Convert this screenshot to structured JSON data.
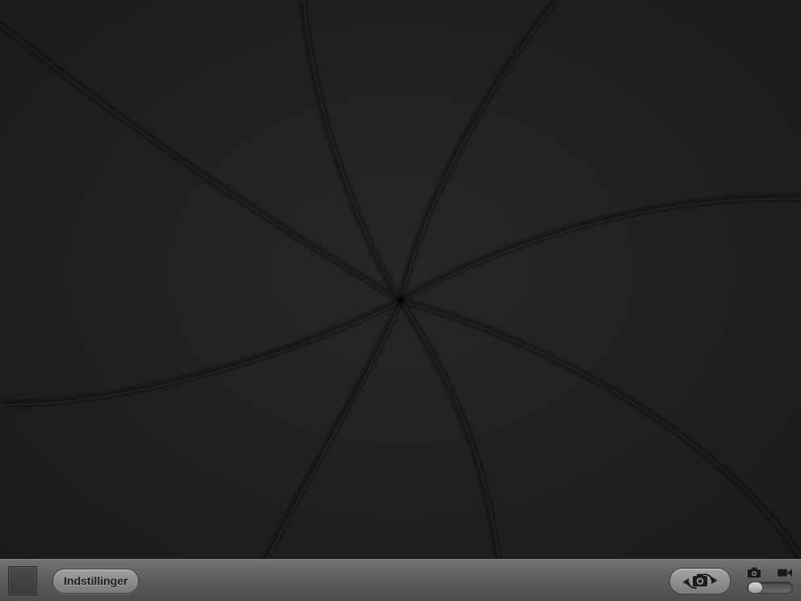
{
  "viewfinder": {
    "state": "shutter-closed",
    "colors": {
      "blade_light": "#2c2c2c",
      "blade_dark": "#161616",
      "edge_shadow": "#0c0c0c",
      "edge_highlight": "#3a3a3a"
    }
  },
  "toolbar": {
    "thumbnail_icon": "last-photo-thumbnail",
    "settings_label": "Indstillinger",
    "flip_camera_icon": "camera-flip-icon",
    "mode_switch": {
      "photo_icon": "camera-icon",
      "video_icon": "video-camera-icon",
      "selected": "photo"
    },
    "colors": {
      "bar": "#707070",
      "button": "#8c8c8c",
      "button_text": "#1d1d1d"
    }
  }
}
